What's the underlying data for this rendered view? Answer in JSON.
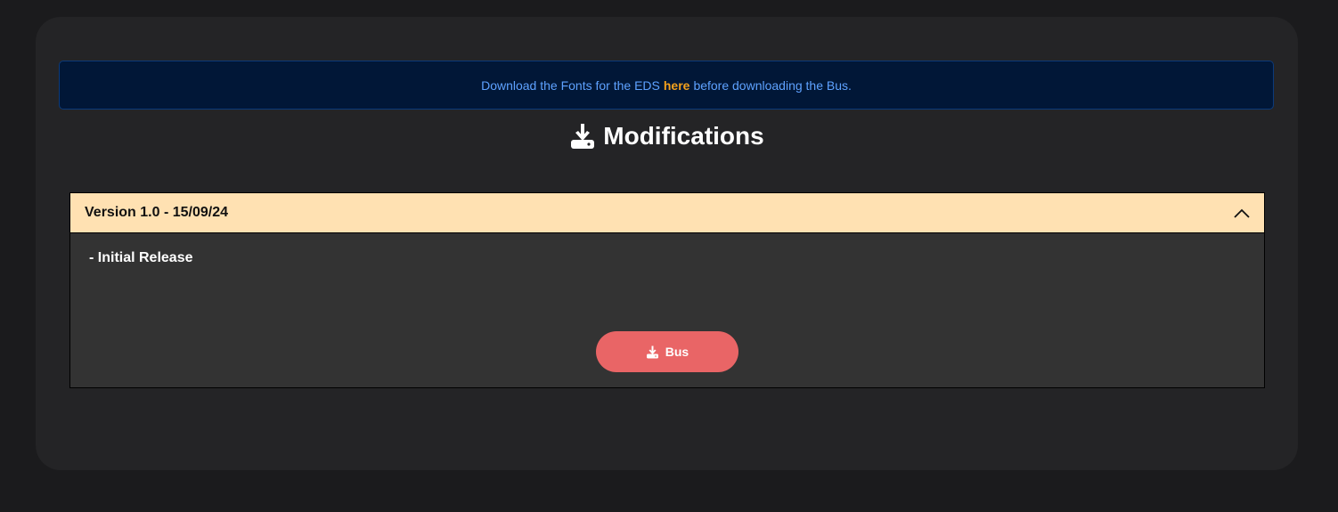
{
  "notice": {
    "prefix": "Download the Fonts for the EDS",
    "link": "here",
    "suffix": "before downloading the Bus."
  },
  "heading": {
    "icon": "download-icon",
    "title": "Modifications"
  },
  "accordion": {
    "title": "Version 1.0 - 15/09/24",
    "toggle_icon": "chevron-up-icon",
    "content": "- Initial Release",
    "button_icon": "download-icon",
    "button_label": "Bus"
  },
  "colors": {
    "page_bg": "#1b1b1d",
    "card_bg": "#242426",
    "notice_bg": "#011737",
    "notice_text": "#5ea2ff",
    "link": "#f5a11c",
    "accordion_header": "#ffe1b2",
    "accordion_body": "#333333",
    "button": "#e96566"
  }
}
